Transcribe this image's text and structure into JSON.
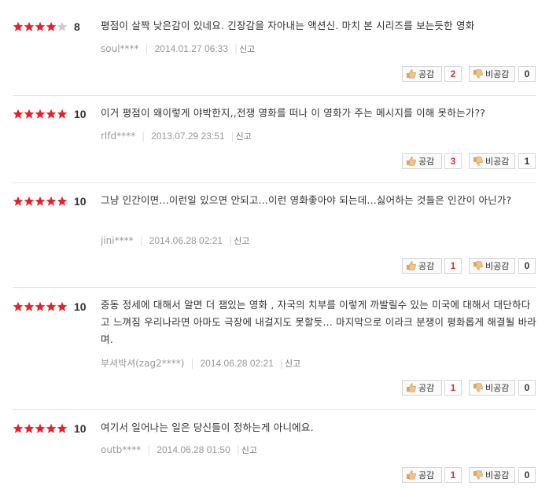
{
  "reviews": [
    {
      "stars": 4,
      "score": "8",
      "text": "평점이 살짝 낮은감이 있네요. 긴장감을 자아내는 액션신. 마치 본 시리즈를 보는듯한 영화",
      "user": "soul****",
      "date": "2014.01.27 06:33",
      "report": "신고",
      "agree_label": "공감",
      "agree_count": "2",
      "disagree_label": "비공감",
      "disagree_count": "0"
    },
    {
      "stars": 5,
      "score": "10",
      "text": "이거 평점이 왜이렇게 야박한지,,전쟁 영화를 떠나 이 영화가 주는 메시지를 이해 못하는가??",
      "user": "rlfd****",
      "date": "2013.07.29 23:51",
      "report": "신고",
      "agree_label": "공감",
      "agree_count": "3",
      "disagree_label": "비공감",
      "disagree_count": "1"
    },
    {
      "stars": 5,
      "score": "10",
      "text": "그냥 인간이면...이런일 있으면 안되고...이런 영화좋아야 되는데...싫어하는 것들은 인간이 아닌가?",
      "user": "jini****",
      "date": "2014.06.28 02:21",
      "report": "신고",
      "agree_label": "공감",
      "agree_count": "1",
      "disagree_label": "비공감",
      "disagree_count": "0"
    },
    {
      "stars": 5,
      "score": "10",
      "text": "중동 정세에 대해서 알면 더 잼있는 영화 , 자국의 치부를 이렇게 까발릴수 있는 미국에 대해서 대단하다고 느껴짐 우리나라면 아마도 극장에 내걸지도 못할듯... 마지막으로 이라크 분쟁이 평화롭게 해결될 바라며.",
      "user": "부셔박셔(zag2****)",
      "date": "2014.06.28 02:21",
      "report": "신고",
      "agree_label": "공감",
      "agree_count": "1",
      "disagree_label": "비공감",
      "disagree_count": "0"
    },
    {
      "stars": 5,
      "score": "10",
      "text": "여기서 일어나는 일은 당신들이 정하는게 아니에요.",
      "user": "outb****",
      "date": "2014.06.28 01:50",
      "report": "신고",
      "agree_label": "공감",
      "agree_count": "1",
      "disagree_label": "비공감",
      "disagree_count": "0"
    }
  ],
  "colors": {
    "star_on": "#e8202a",
    "star_off": "#cccccc",
    "agree_count": "#e0312e"
  },
  "icons": {
    "agree": "thumbs-up-icon",
    "disagree": "thumbs-down-icon",
    "star": "star-icon"
  }
}
